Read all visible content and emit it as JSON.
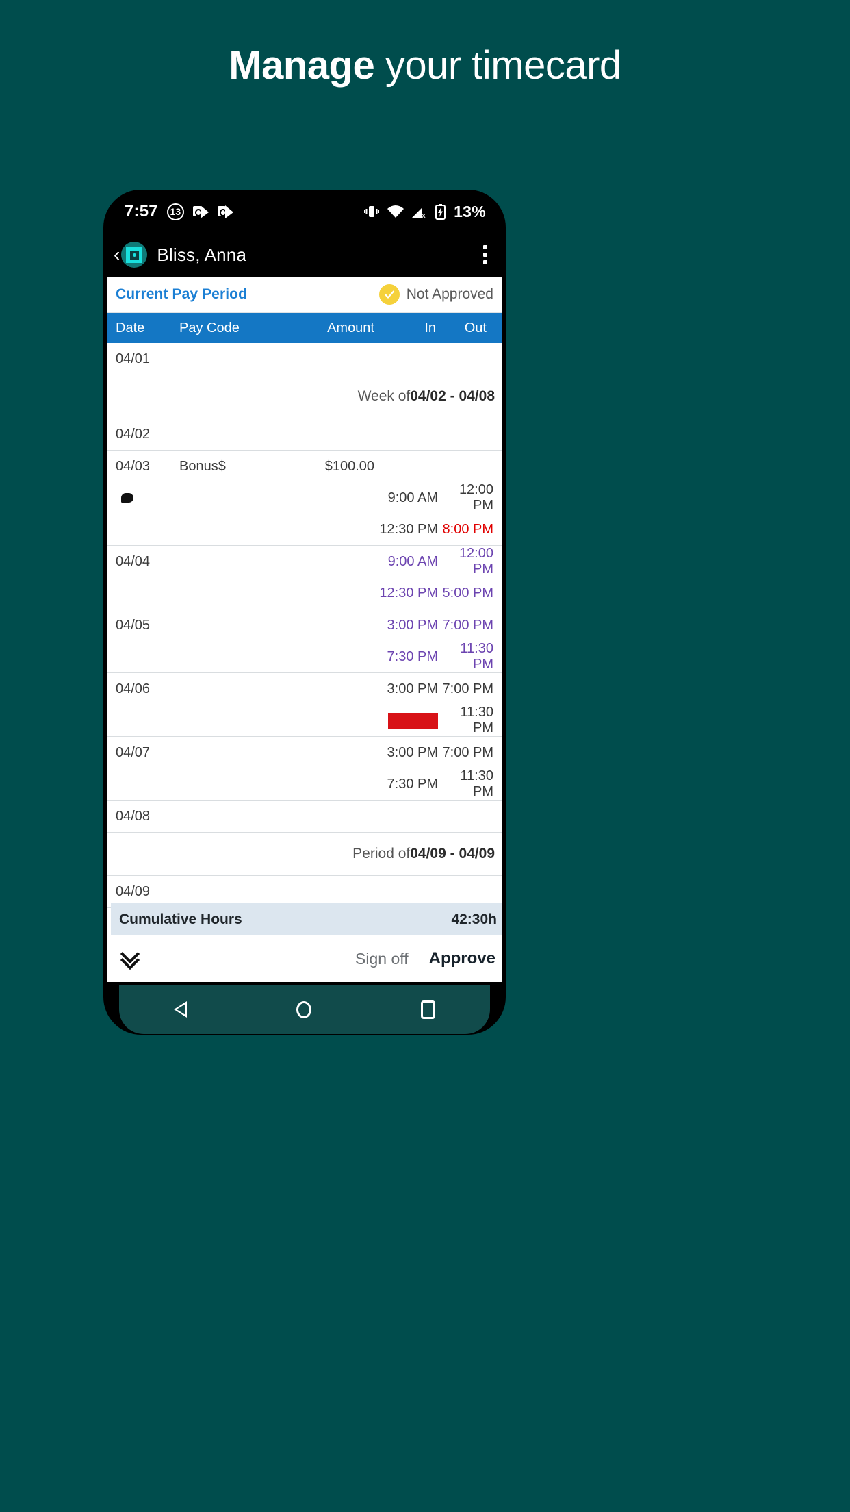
{
  "headline": {
    "bold": "Manage",
    "light": " your timecard"
  },
  "status_bar": {
    "time": "7:57",
    "notification_count": "13",
    "icons": [
      "outlook-icon",
      "outlook-icon",
      "vibrate-icon",
      "wifi-icon",
      "cellular-signal-off-icon",
      "battery-charging-icon"
    ],
    "battery_percent": "13%"
  },
  "app_bar": {
    "back_label": "‹",
    "title": "Bliss, Anna",
    "overflow_label": "more-options"
  },
  "period_header": {
    "title": "Current Pay Period",
    "approval_status": "Not Approved",
    "badge_color": "#f5d13b",
    "title_color": "#1b7fd4"
  },
  "table": {
    "columns": [
      "Date",
      "Pay Code",
      "Amount",
      "In",
      "Out"
    ],
    "header_bg": "#1477c4",
    "rows": [
      {
        "kind": "entry",
        "date": "04/01",
        "pay_code": "",
        "amount": "",
        "lines": []
      },
      {
        "kind": "divider",
        "prefix": "Week of ",
        "range": "04/02 - 04/08"
      },
      {
        "kind": "entry",
        "date": "04/02",
        "pay_code": "",
        "amount": "",
        "lines": []
      },
      {
        "kind": "entry",
        "date": "04/03",
        "pay_code": "Bonus$",
        "amount": "$100.00",
        "has_comment": true,
        "lines": [
          {
            "in": "9:00 AM",
            "out": "12:00 PM",
            "in_color": "grey",
            "out_color": "grey"
          },
          {
            "in": "12:30 PM",
            "out": "8:00 PM",
            "in_color": "grey",
            "out_color": "red"
          }
        ]
      },
      {
        "kind": "entry",
        "date": "04/04",
        "pay_code": "",
        "amount": "",
        "lines": [
          {
            "in": "9:00 AM",
            "out": "12:00 PM",
            "in_color": "purple",
            "out_color": "purple"
          },
          {
            "in": "12:30 PM",
            "out": "5:00 PM",
            "in_color": "purple",
            "out_color": "purple"
          }
        ]
      },
      {
        "kind": "entry",
        "date": "04/05",
        "pay_code": "",
        "amount": "",
        "lines": [
          {
            "in": "3:00 PM",
            "out": "7:00 PM",
            "in_color": "purple",
            "out_color": "purple"
          },
          {
            "in": "7:30 PM",
            "out": "11:30 PM",
            "in_color": "purple",
            "out_color": "purple"
          }
        ]
      },
      {
        "kind": "entry",
        "date": "04/06",
        "pay_code": "",
        "amount": "",
        "lines": [
          {
            "in": "3:00 PM",
            "out": "7:00 PM",
            "in_color": "grey",
            "out_color": "grey"
          },
          {
            "in": "",
            "in_redacted": true,
            "out": "11:30 PM",
            "in_color": "grey",
            "out_color": "grey"
          }
        ]
      },
      {
        "kind": "entry",
        "date": "04/07",
        "pay_code": "",
        "amount": "",
        "lines": [
          {
            "in": "3:00 PM",
            "out": "7:00 PM",
            "in_color": "grey",
            "out_color": "grey"
          },
          {
            "in": "7:30 PM",
            "out": "11:30 PM",
            "in_color": "grey",
            "out_color": "grey"
          }
        ]
      },
      {
        "kind": "entry",
        "date": "04/08",
        "pay_code": "",
        "amount": "",
        "lines": []
      },
      {
        "kind": "divider",
        "prefix": "Period of ",
        "range": "04/09 - 04/09"
      },
      {
        "kind": "entry",
        "date": "04/09",
        "pay_code": "",
        "amount": "",
        "lines": []
      },
      {
        "kind": "blank"
      }
    ]
  },
  "summary": {
    "label": "Cumulative Hours",
    "value": "42:30h"
  },
  "actions": {
    "expand_label": "expand-chevron",
    "sign_off": "Sign off",
    "approve": "Approve"
  },
  "nav_bar": {
    "back": "back-icon",
    "home": "home-icon",
    "recents": "recents-icon"
  }
}
